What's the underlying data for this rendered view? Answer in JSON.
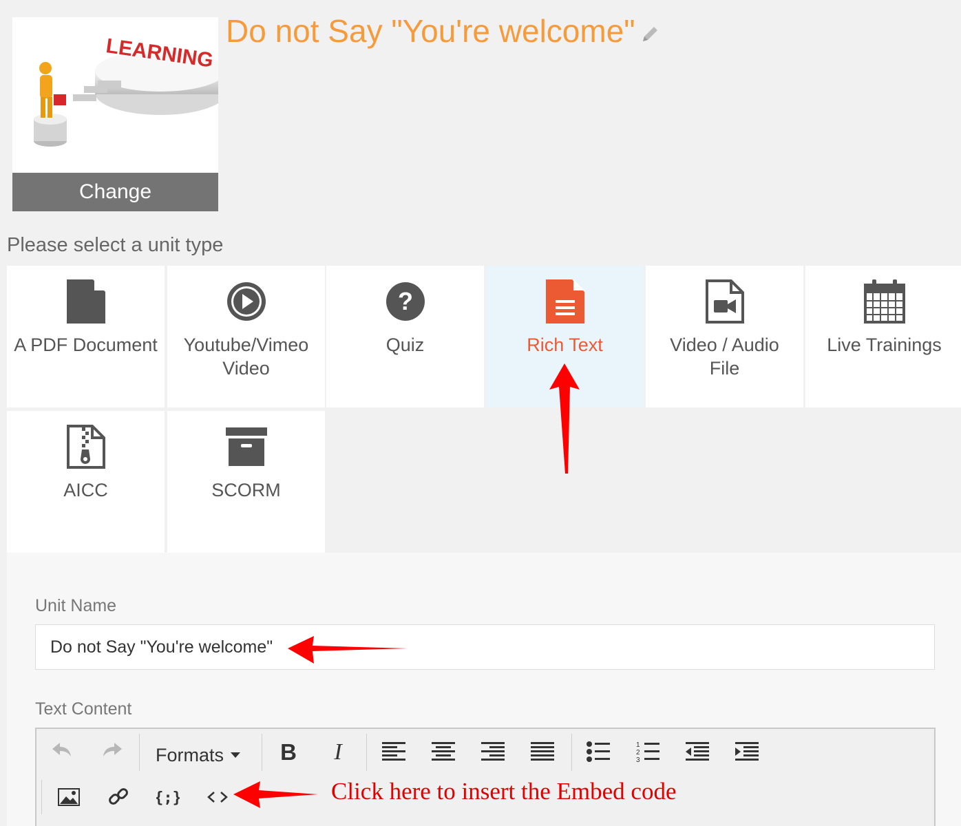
{
  "course": {
    "title": "Do not Say \"You're welcome\"",
    "thumbnail_text": "LEARNING",
    "change_label": "Change"
  },
  "unit_types": {
    "heading": "Please select a unit type",
    "items": [
      {
        "key": "pdf",
        "label": "A PDF Document",
        "icon": "file-icon"
      },
      {
        "key": "youtube",
        "label": "Youtube/Vimeo Video",
        "icon": "play-circle-icon"
      },
      {
        "key": "quiz",
        "label": "Quiz",
        "icon": "question-circle-icon"
      },
      {
        "key": "richtext",
        "label": "Rich Text",
        "icon": "document-text-icon",
        "selected": true
      },
      {
        "key": "video",
        "label": "Video / Audio File",
        "icon": "file-video-icon"
      },
      {
        "key": "live",
        "label": "Live Trainings",
        "icon": "calendar-icon"
      },
      {
        "key": "aicc",
        "label": "AICC",
        "icon": "file-archive-icon"
      },
      {
        "key": "scorm",
        "label": "SCORM",
        "icon": "archive-box-icon"
      }
    ]
  },
  "form": {
    "unit_name_label": "Unit Name",
    "unit_name_value": "Do not Say \"You're welcome\"",
    "text_content_label": "Text Content",
    "toolbar": {
      "formats_label": "Formats",
      "bold_label": "B",
      "italic_label": "I"
    }
  },
  "annotation": "Click here to insert the Embed code",
  "colors": {
    "accent_orange": "#f59b3b",
    "selected_red": "#ec5a34",
    "arrow_red": "#ff0000",
    "icon_gray": "#555555"
  }
}
